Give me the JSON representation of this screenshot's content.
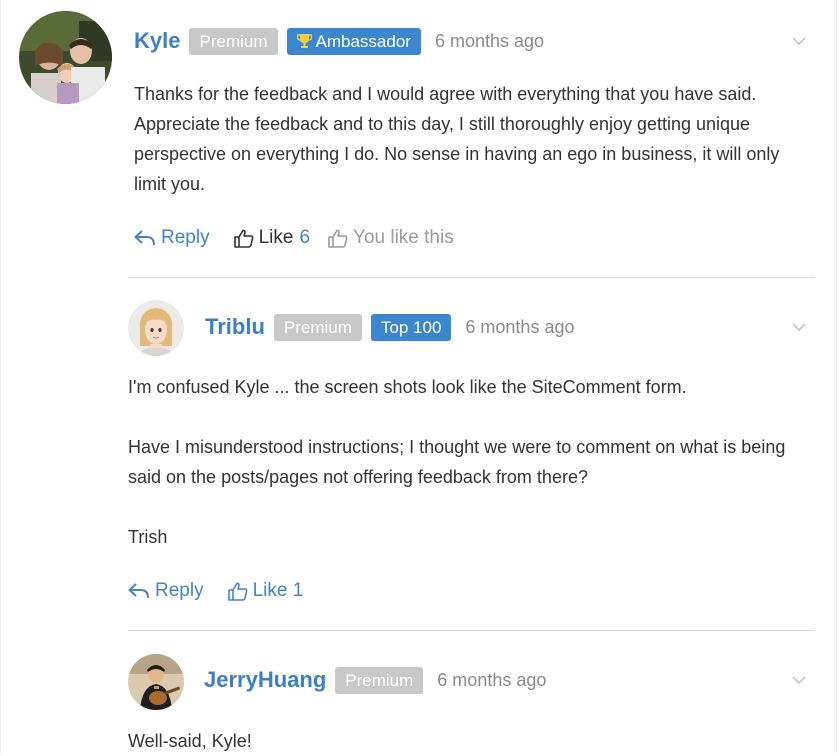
{
  "comments": [
    {
      "username": "Kyle",
      "badges": [
        "Premium",
        "Ambassador"
      ],
      "time": "6 months ago",
      "paragraphs": [
        "Thanks for the feedback and I would agree with everything that you have said. Appreciate the feedback and to this day, I still thoroughly enjoy getting unique perspective on everything I do. No sense in having an ego in business, it will only limit you."
      ],
      "reply_label": "Reply",
      "like_label": "Like",
      "like_count": "6",
      "you_like_label": "You like this"
    },
    {
      "username": "Triblu",
      "badges": [
        "Premium",
        "Top 100"
      ],
      "time": "6 months ago",
      "paragraphs": [
        "I'm confused Kyle ... the screen shots look like the SiteComment form.",
        "Have I misunderstood instructions; I thought we were to comment on what is being said on the posts/pages not offering feedback from there?",
        "Trish"
      ],
      "reply_label": "Reply",
      "like_label": "Like 1"
    },
    {
      "username": "JerryHuang",
      "badges": [
        "Premium"
      ],
      "time": "6 months ago",
      "paragraphs": [
        "Well-said, Kyle!"
      ]
    }
  ],
  "colors": {
    "link_blue": "#3c7fc2",
    "badge_premium": "#c8c8c8",
    "badge_blue": "#3b86cf"
  },
  "icons": [
    "trophy-icon",
    "chevron-down-icon",
    "reply-icon",
    "thumbs-up-icon"
  ]
}
